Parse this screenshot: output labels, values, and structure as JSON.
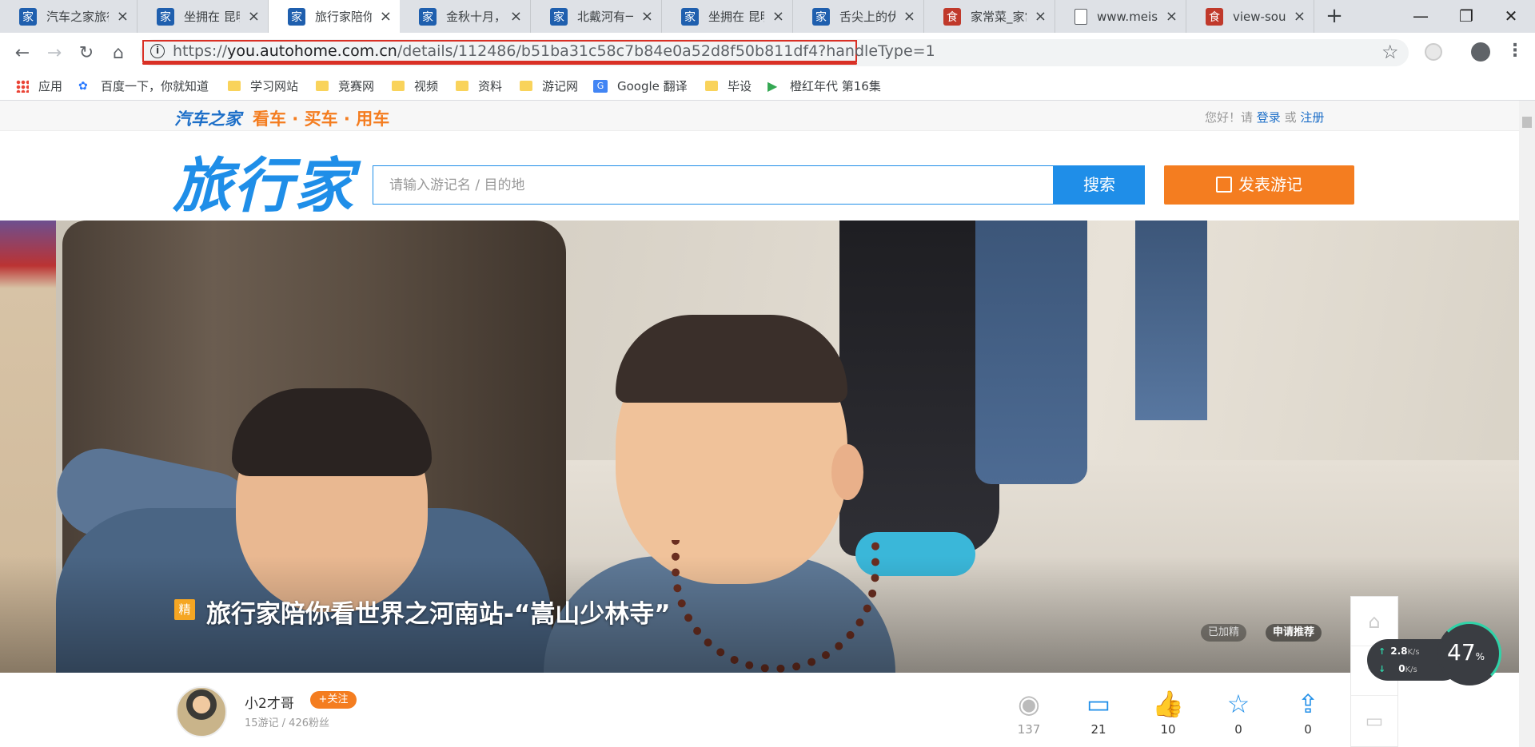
{
  "browser": {
    "tabs": [
      {
        "label": "汽车之家旅行家",
        "icon": "autohome-favicon"
      },
      {
        "label": "坐拥在 昆明滇池",
        "icon": "autohome-favicon"
      },
      {
        "label": "旅行家陪你看世界",
        "icon": "autohome-favicon",
        "active": true
      },
      {
        "label": "金秋十月，飞",
        "icon": "autohome-favicon"
      },
      {
        "label": "北戴河有一种",
        "icon": "autohome-favicon"
      },
      {
        "label": "坐拥在 昆明滇池",
        "icon": "autohome-favicon"
      },
      {
        "label": "舌尖上的伏天",
        "icon": "autohome-favicon"
      },
      {
        "label": "家常菜_家常菜",
        "icon": "meishi-favicon"
      },
      {
        "label": "www.meishi",
        "icon": "document-icon"
      },
      {
        "label": "view-source:",
        "icon": "meishi-favicon"
      }
    ],
    "new_tab": "+",
    "window_controls": {
      "minimize": "—",
      "maximize": "❐",
      "close": "✕"
    },
    "nav": {
      "back": "←",
      "forward": "→",
      "reload": "↻",
      "home": "⌂"
    },
    "url": {
      "scheme": "https://",
      "host": "you.autohome.com.cn",
      "path": "/details/112486/b51ba31c58c7b84e0a52d8f50b811df4?handleType=1"
    },
    "bookmarks": [
      {
        "label": "应用",
        "icon": "apps-grid-icon"
      },
      {
        "label": "百度一下，你就知道",
        "icon": "baidu-paw-icon"
      },
      {
        "label": "学习网站",
        "icon": "folder-icon"
      },
      {
        "label": "竞赛网",
        "icon": "folder-icon"
      },
      {
        "label": "视频",
        "icon": "folder-icon"
      },
      {
        "label": "资料",
        "icon": "folder-icon"
      },
      {
        "label": "游记网",
        "icon": "folder-icon"
      },
      {
        "label": "Google 翻译",
        "icon": "google-translate-icon"
      },
      {
        "label": "毕设",
        "icon": "folder-icon"
      },
      {
        "label": "橙红年代 第16集",
        "icon": "play-icon"
      }
    ]
  },
  "site": {
    "brand": "汽车之家",
    "slogan": "看车 · 买车 · 用车",
    "greeting_prefix": "您好！请",
    "login": "登录",
    "or": "或",
    "register": "注册",
    "logo": "旅行家",
    "search_placeholder": "请输入游记名 / 目的地",
    "search_button": "搜索",
    "post_button": "发表游记"
  },
  "article": {
    "badge": "精",
    "title": "旅行家陪你看世界之河南站-“嵩山少林寺”",
    "tag_added": "已加精",
    "tag_recommend": "申请推荐"
  },
  "author": {
    "name": "小2才哥",
    "follow": "+关注",
    "stats": "15游记 / 426粉丝"
  },
  "stats": [
    {
      "icon": "eye-icon",
      "value": "137"
    },
    {
      "icon": "comment-icon",
      "value": "21"
    },
    {
      "icon": "thumbs-up-icon",
      "value": "10"
    },
    {
      "icon": "star-icon",
      "value": "0"
    },
    {
      "icon": "share-icon",
      "value": "0"
    }
  ],
  "speed_widget": {
    "up": "2.8",
    "down": "0",
    "unit": "K/s",
    "percent": "47",
    "percent_unit": "%"
  }
}
